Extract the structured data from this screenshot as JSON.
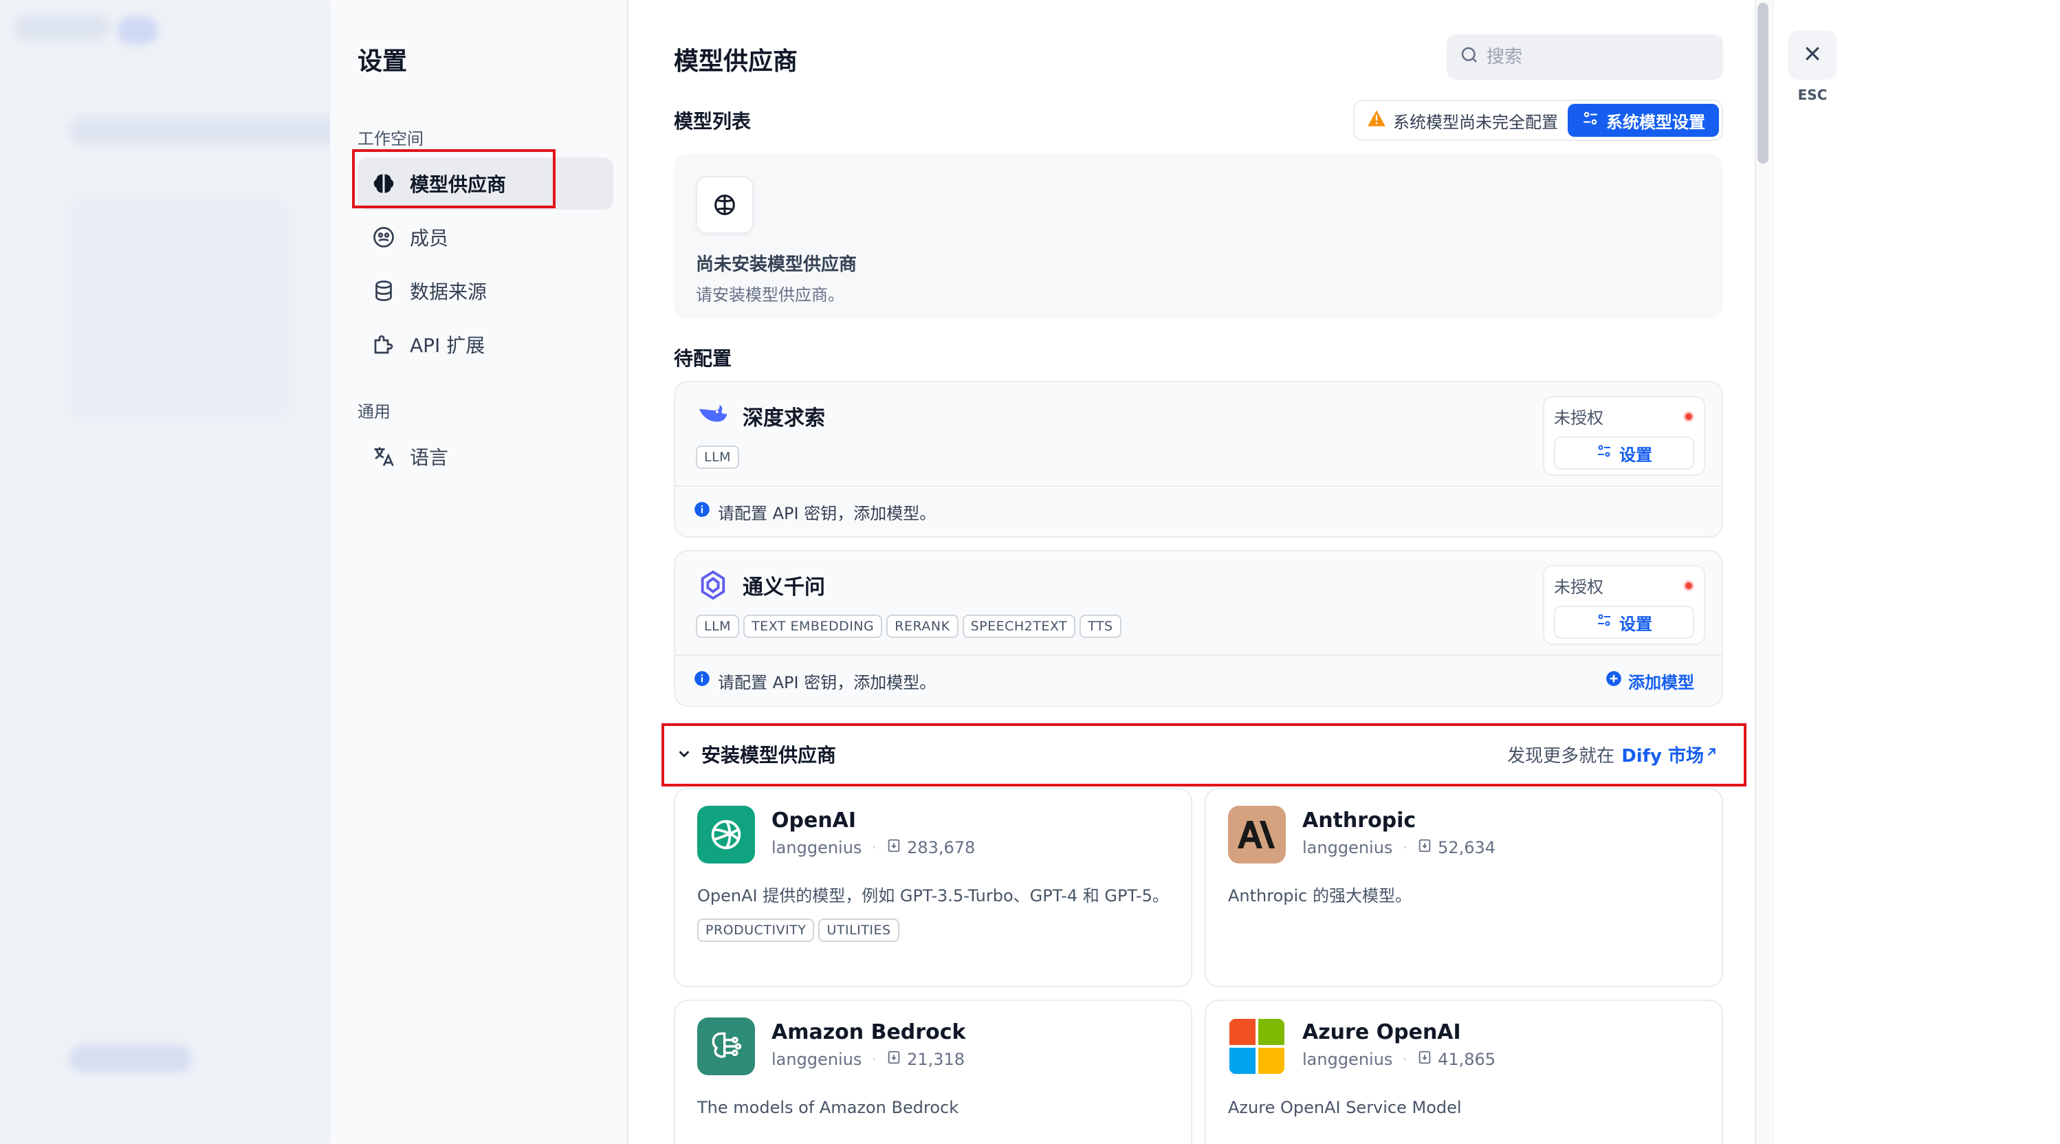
{
  "settings": {
    "title": "设置",
    "workspace_label": "工作空间",
    "general_label": "通用",
    "nav": [
      {
        "label": "模型供应商",
        "icon": "brain-icon"
      },
      {
        "label": "成员",
        "icon": "members-icon"
      },
      {
        "label": "数据来源",
        "icon": "database-icon"
      },
      {
        "label": "API 扩展",
        "icon": "puzzle-icon"
      }
    ],
    "general_nav": [
      {
        "label": "语言",
        "icon": "translate-icon"
      }
    ]
  },
  "main": {
    "title": "模型供应商",
    "search_placeholder": "搜索",
    "model_list_label": "模型列表",
    "sys_warning": "系统模型尚未完全配置",
    "sys_button": "系统模型设置",
    "empty_title": "尚未安装模型供应商",
    "empty_desc": "请安装模型供应商。",
    "pending_label": "待配置",
    "providers": [
      {
        "name": "深度求索",
        "tags": [
          "LLM"
        ],
        "status": "未授权",
        "setup_label": "设置",
        "info": "请配置 API 密钥，添加模型。"
      },
      {
        "name": "通义千问",
        "tags": [
          "LLM",
          "TEXT EMBEDDING",
          "RERANK",
          "SPEECH2TEXT",
          "TTS"
        ],
        "status": "未授权",
        "setup_label": "设置",
        "info": "请配置 API 密钥，添加模型。",
        "add_model": "添加模型"
      }
    ],
    "install_title": "安装模型供应商",
    "market_prefix": "发现更多就在",
    "market_link": "Dify 市场",
    "plugins": [
      {
        "name": "OpenAI",
        "author": "langgenius",
        "downloads": "283,678",
        "desc": "OpenAI 提供的模型，例如 GPT-3.5-Turbo、GPT-4 和 GPT-5。",
        "tags": [
          "PRODUCTIVITY",
          "UTILITIES"
        ],
        "logo_color": "#10a37f"
      },
      {
        "name": "Anthropic",
        "author": "langgenius",
        "downloads": "52,634",
        "desc": "Anthropic 的强大模型。",
        "tags": [],
        "logo_color": "#d4a27f"
      },
      {
        "name": "Amazon Bedrock",
        "author": "langgenius",
        "downloads": "21,318",
        "desc": "The models of Amazon Bedrock",
        "tags": [],
        "logo_color": "#2e8b75"
      },
      {
        "name": "Azure OpenAI",
        "author": "langgenius",
        "downloads": "41,865",
        "desc": "Azure OpenAI Service Model",
        "tags": [],
        "logo_color": "#f25022"
      }
    ]
  },
  "close": {
    "label": "ESC"
  },
  "colors": {
    "accent": "#155eef",
    "highlight": "#e0151b",
    "warning": "#f79009"
  }
}
